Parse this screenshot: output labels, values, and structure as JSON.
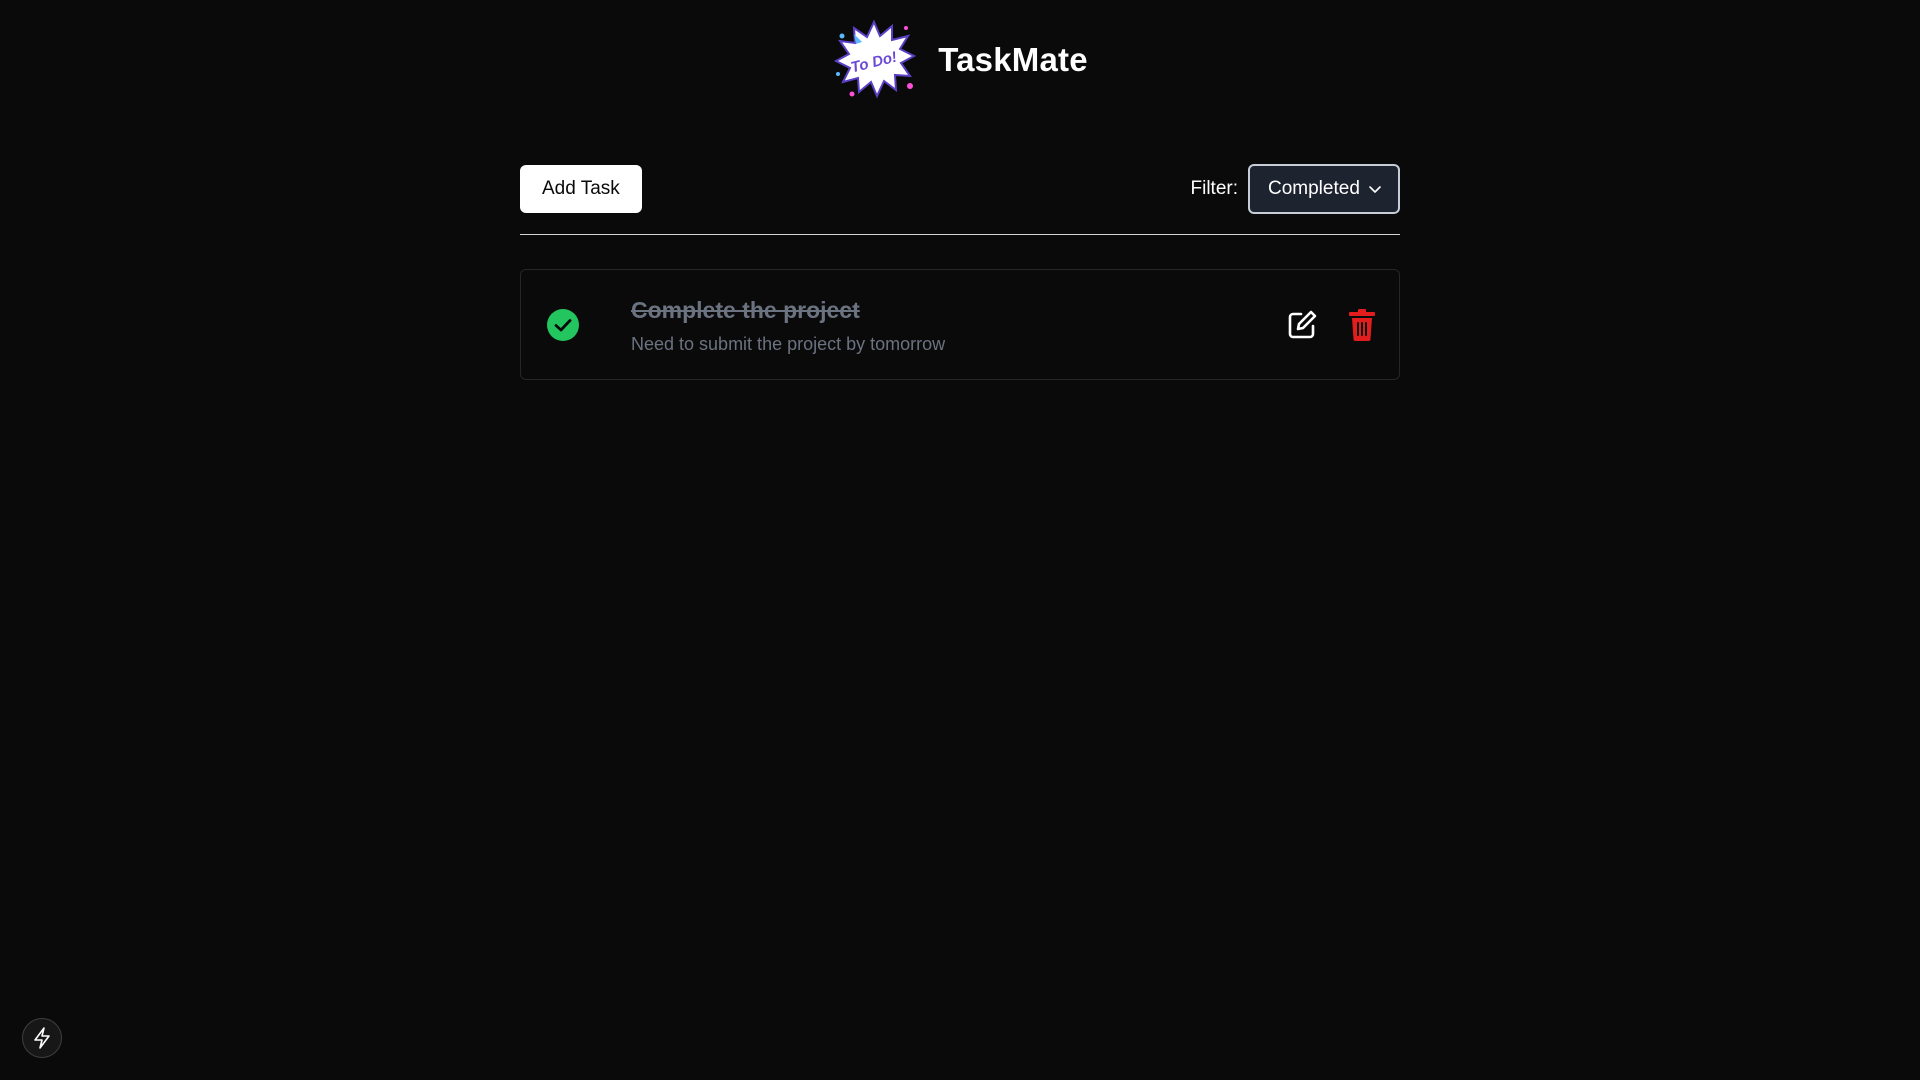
{
  "header": {
    "logo_text": "To Do!",
    "title": "TaskMate"
  },
  "toolbar": {
    "add_task_label": "Add Task",
    "filter_label": "Filter:",
    "filter_selected": "Completed"
  },
  "tasks": [
    {
      "title": "Complete the project",
      "description": "Need to submit the project by tomorrow",
      "completed": true
    }
  ],
  "icons": {
    "logo": "todo-burst-logo-icon",
    "filter_chevron": "chevron-down-icon",
    "complete": "check-circle-icon",
    "edit": "edit-icon",
    "delete": "trash-icon",
    "corner": "lightning-icon"
  },
  "colors": {
    "background": "#0a0a0a",
    "check_green": "#22c55e",
    "delete_red": "#e11d1d",
    "muted_text": "#6b7280",
    "select_bg": "#1d2430"
  }
}
